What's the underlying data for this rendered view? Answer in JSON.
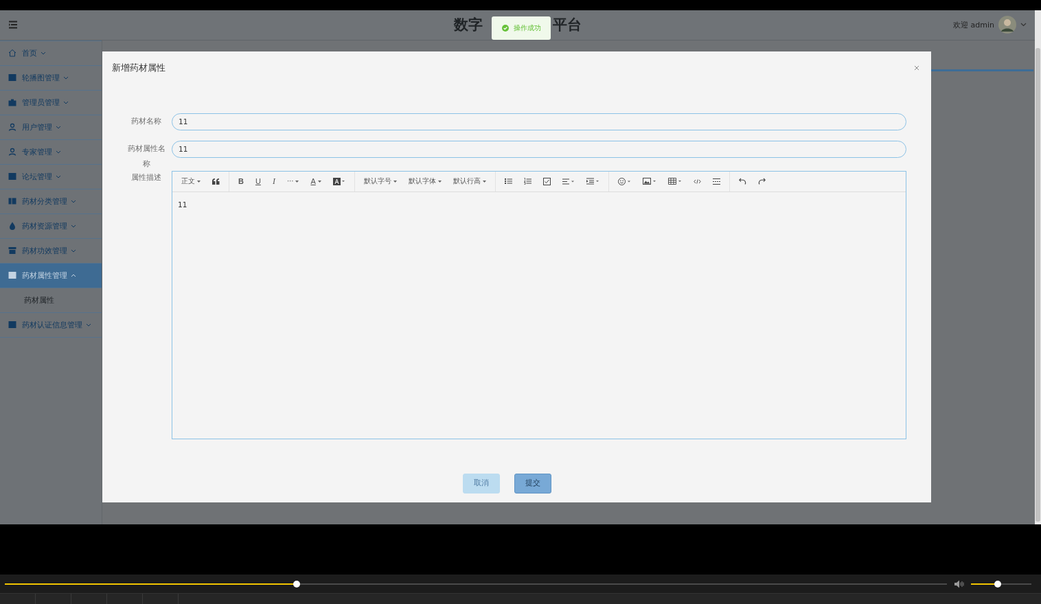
{
  "header": {
    "title_left": "数字",
    "title_right": "平台",
    "welcome": "欢迎 admin"
  },
  "toast": {
    "message": "操作成功"
  },
  "sidebar": {
    "items": [
      {
        "label": "首页",
        "expanded": false,
        "selected": false
      },
      {
        "label": "轮播图管理",
        "expanded": false,
        "selected": false
      },
      {
        "label": "管理员管理",
        "expanded": false,
        "selected": false
      },
      {
        "label": "用户管理",
        "expanded": false,
        "selected": false
      },
      {
        "label": "专家管理",
        "expanded": false,
        "selected": false
      },
      {
        "label": "论坛管理",
        "expanded": false,
        "selected": false
      },
      {
        "label": "药材分类管理",
        "expanded": false,
        "selected": false
      },
      {
        "label": "药材资源管理",
        "expanded": false,
        "selected": false
      },
      {
        "label": "药材功效管理",
        "expanded": false,
        "selected": false
      },
      {
        "label": "药材属性管理",
        "expanded": true,
        "selected": true,
        "children": [
          {
            "label": "药材属性",
            "selected": true
          }
        ]
      },
      {
        "label": "药材认证信息管理",
        "expanded": false,
        "selected": false
      }
    ]
  },
  "dialog": {
    "title": "新增药材属性",
    "fields": [
      {
        "label": "药材名称",
        "value": "11"
      },
      {
        "label": "药材属性名称",
        "value": "11"
      }
    ],
    "editor": {
      "label": "属性描述",
      "toolbar": {
        "heading": "正文",
        "bold": "B",
        "underline": "U",
        "italic": "I",
        "more": "···",
        "font_color": "A",
        "font_size": "默认字号",
        "font_family": "默认字体",
        "line_height": "默认行高"
      },
      "content": "11"
    },
    "buttons": [
      {
        "label": "取消",
        "kind": "cancel"
      },
      {
        "label": "提交",
        "kind": "submit"
      }
    ]
  },
  "player": {
    "progress": {
      "level": 0.31
    },
    "volume": {
      "level": 0.44
    }
  }
}
